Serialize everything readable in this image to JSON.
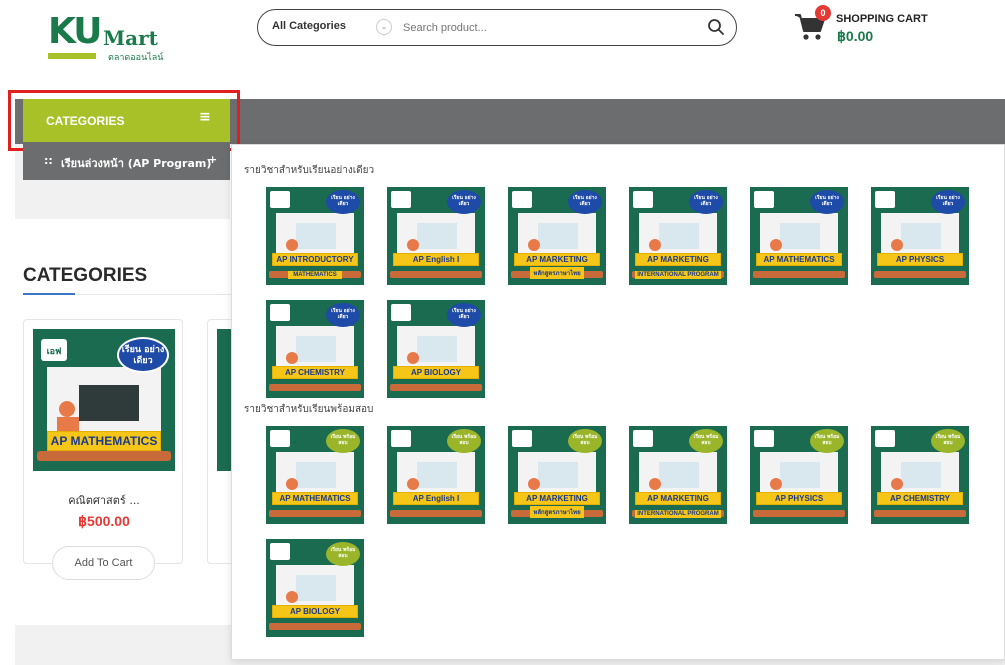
{
  "header": {
    "logo_main": "KU",
    "logo_mart": "Mart",
    "logo_sub": "ตลาดออนไลน์",
    "search": {
      "category": "All Categories",
      "placeholder": "Search product..."
    },
    "cart": {
      "badge": "0",
      "label": "SHOPPING CART",
      "total": "฿0.00"
    }
  },
  "nav": {
    "categories_button": "CATEGORIES",
    "menu_icon": "≡",
    "sub_item": {
      "bullet": "::",
      "label": "เรียนล่วงหน้า (AP Program)",
      "expand": "+"
    }
  },
  "section": {
    "heading": "CATEGORIES"
  },
  "product": {
    "name": "คณิตศาสตร์ ...",
    "price": "฿500.00",
    "add_to_cart": "Add To Cart",
    "image_badge": "เรียน อย่างเดียว",
    "image_label": "AP MATHEMATICS"
  },
  "dropdown": {
    "group1_title": "รายวิชาสำหรับเรียนอย่างเดียว",
    "group2_title": "รายวิชาสำหรับเรียนพร้อมสอบ",
    "group1_badge": "เรียน อย่างเดียว",
    "group2_badge": "เรียน พร้อมสอบ",
    "group1": [
      {
        "label": "AP INTRODUCTORY",
        "sub": "MATHEMATICS"
      },
      {
        "label": "AP English I",
        "sub": ""
      },
      {
        "label": "AP MARKETING",
        "sub": "หลักสูตรภาษาไทย"
      },
      {
        "label": "AP MARKETING",
        "sub": "INTERNATIONAL PROGRAM"
      },
      {
        "label": "AP MATHEMATICS",
        "sub": ""
      },
      {
        "label": "AP PHYSICS",
        "sub": ""
      },
      {
        "label": "AP CHEMISTRY",
        "sub": ""
      },
      {
        "label": "AP BIOLOGY",
        "sub": ""
      }
    ],
    "group2": [
      {
        "label": "AP MATHEMATICS",
        "sub": ""
      },
      {
        "label": "AP English I",
        "sub": ""
      },
      {
        "label": "AP MARKETING",
        "sub": "หลักสูตรภาษาไทย"
      },
      {
        "label": "AP MARKETING",
        "sub": "INTERNATIONAL PROGRAM"
      },
      {
        "label": "AP PHYSICS",
        "sub": ""
      },
      {
        "label": "AP CHEMISTRY",
        "sub": ""
      },
      {
        "label": "AP BIOLOGY",
        "sub": ""
      }
    ]
  },
  "colors": {
    "brand_green": "#1a7a4a",
    "accent_lime": "#a8c128",
    "nav_gray": "#6b6d6f",
    "price_red": "#e53935",
    "highlight_red": "#e01f1f",
    "thumb_bg": "#1b6b50"
  }
}
